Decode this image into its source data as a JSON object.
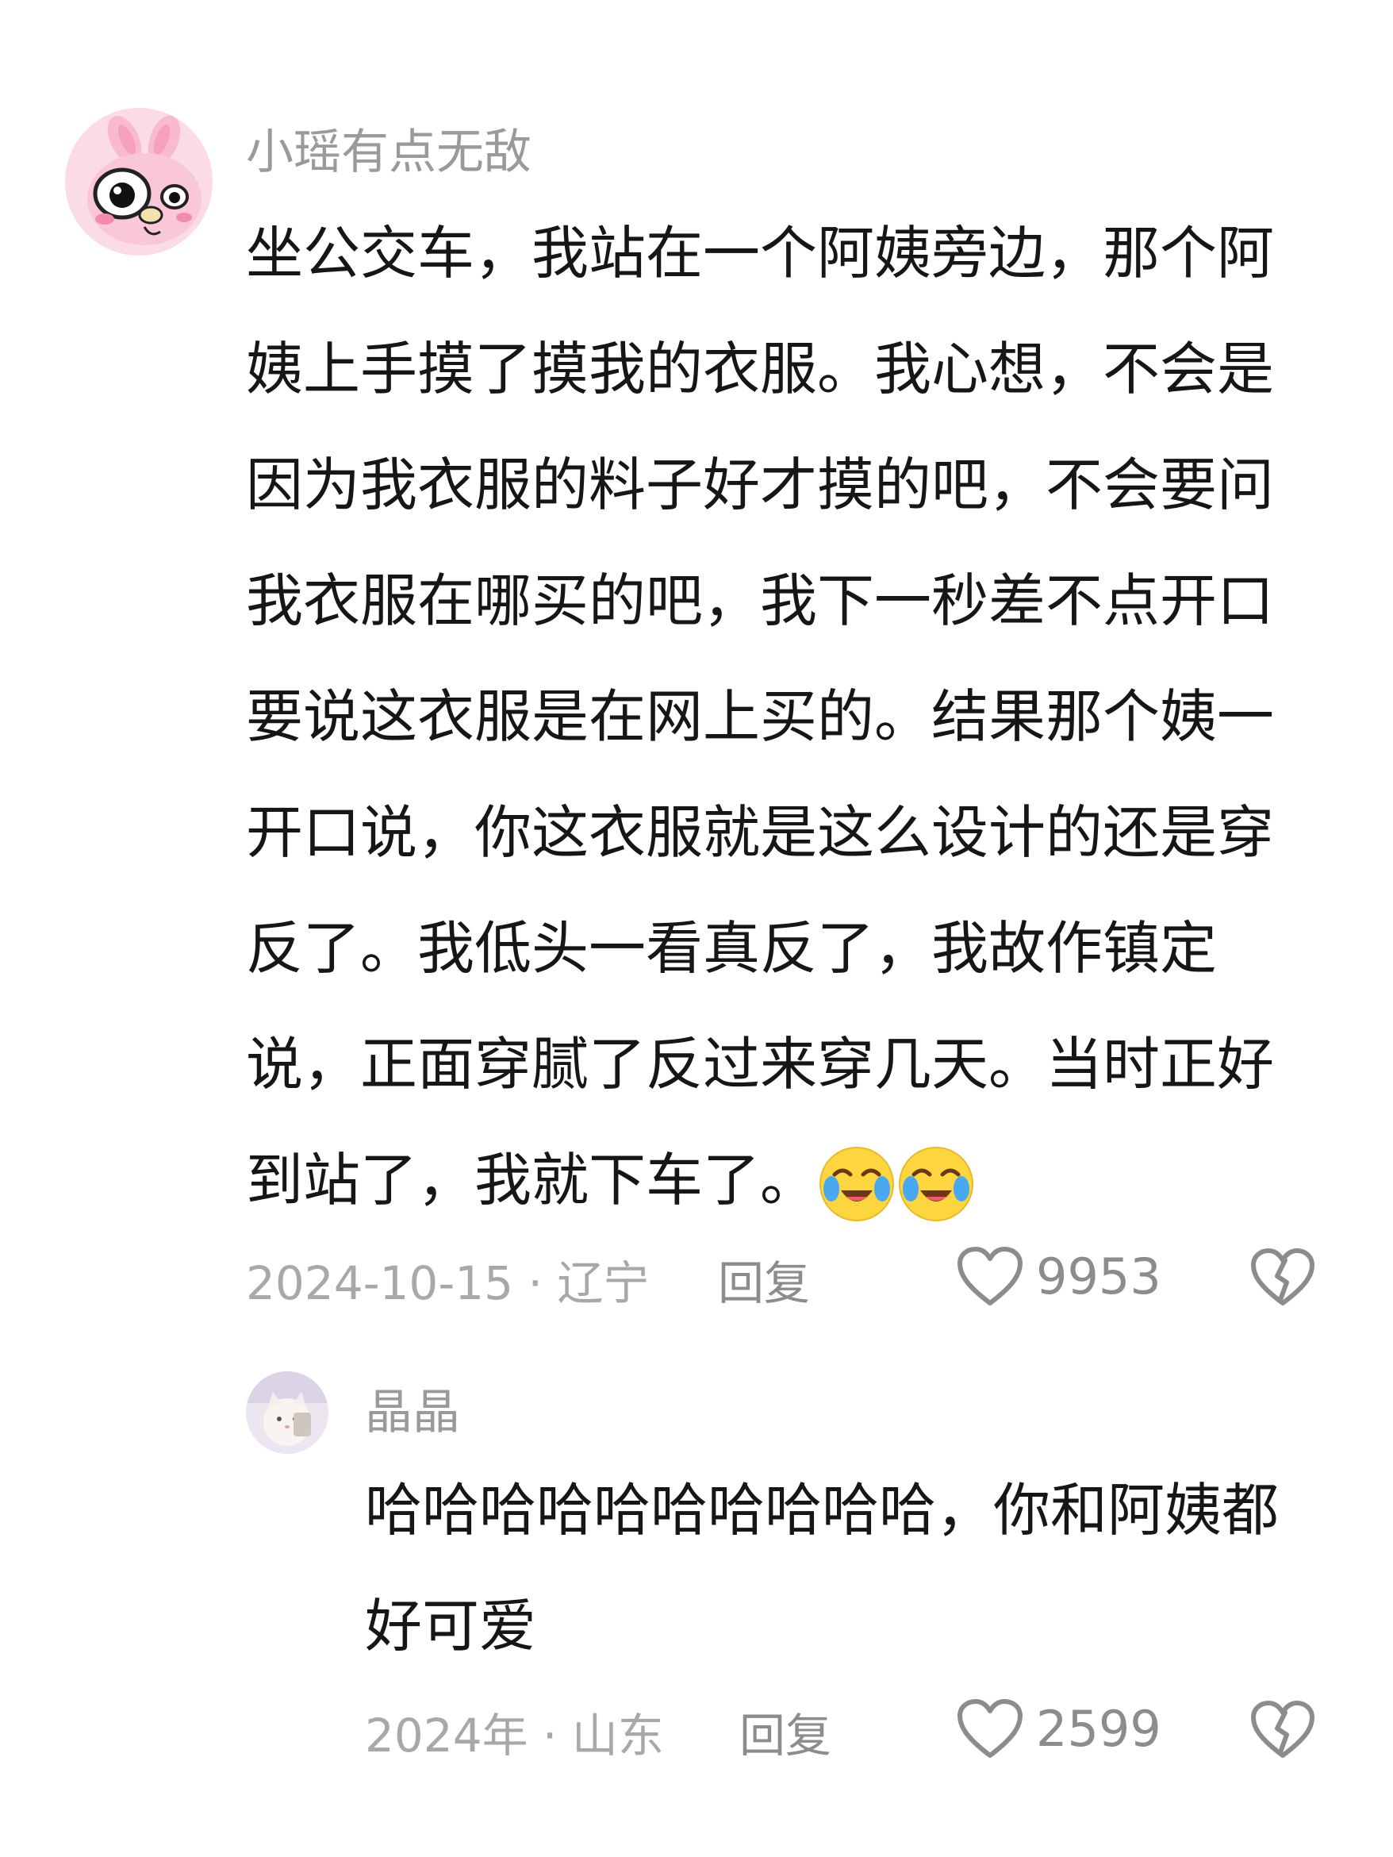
{
  "main_comment": {
    "username": "小瑶有点无敌",
    "text_lines": [
      "坐公交车，我站在一个阿姨旁边，那个阿",
      "姨上手摸了摸我的衣服。我心想，不会是",
      "因为我衣服的料子好才摸的吧，不会要问",
      "我衣服在哪买的吧，我下一秒差不点开口",
      "要说这衣服是在网上买的。结果那个姨一",
      "开口说，你这衣服就是这么设计的还是穿",
      "反了。我低头一看真反了，我故作镇定",
      "说，正面穿腻了反过来穿几天。当时正好",
      "到站了，我就下车了。"
    ],
    "emojis": [
      "crying-laughing-emoji",
      "crying-laughing-emoji"
    ],
    "date_location": "2024-10-15 · 辽宁",
    "reply_label": "回复",
    "like_count": "9953",
    "avatar_icon": "pink-bunny-avatar"
  },
  "reply_comment": {
    "username": "晶晶",
    "text_lines": [
      "哈哈哈哈哈哈哈哈哈哈，你和阿姨都",
      "好可爱"
    ],
    "date_location": "2024年 · 山东",
    "reply_label": "回复",
    "like_count": "2599",
    "avatar_icon": "cat-photo-avatar"
  },
  "icons": {
    "like": "heart-outline-icon",
    "dislike": "broken-heart-icon"
  },
  "colors": {
    "text": "#161616",
    "muted": "#9a9a9a",
    "icon": "#8c8c8c",
    "background": "#ffffff"
  }
}
